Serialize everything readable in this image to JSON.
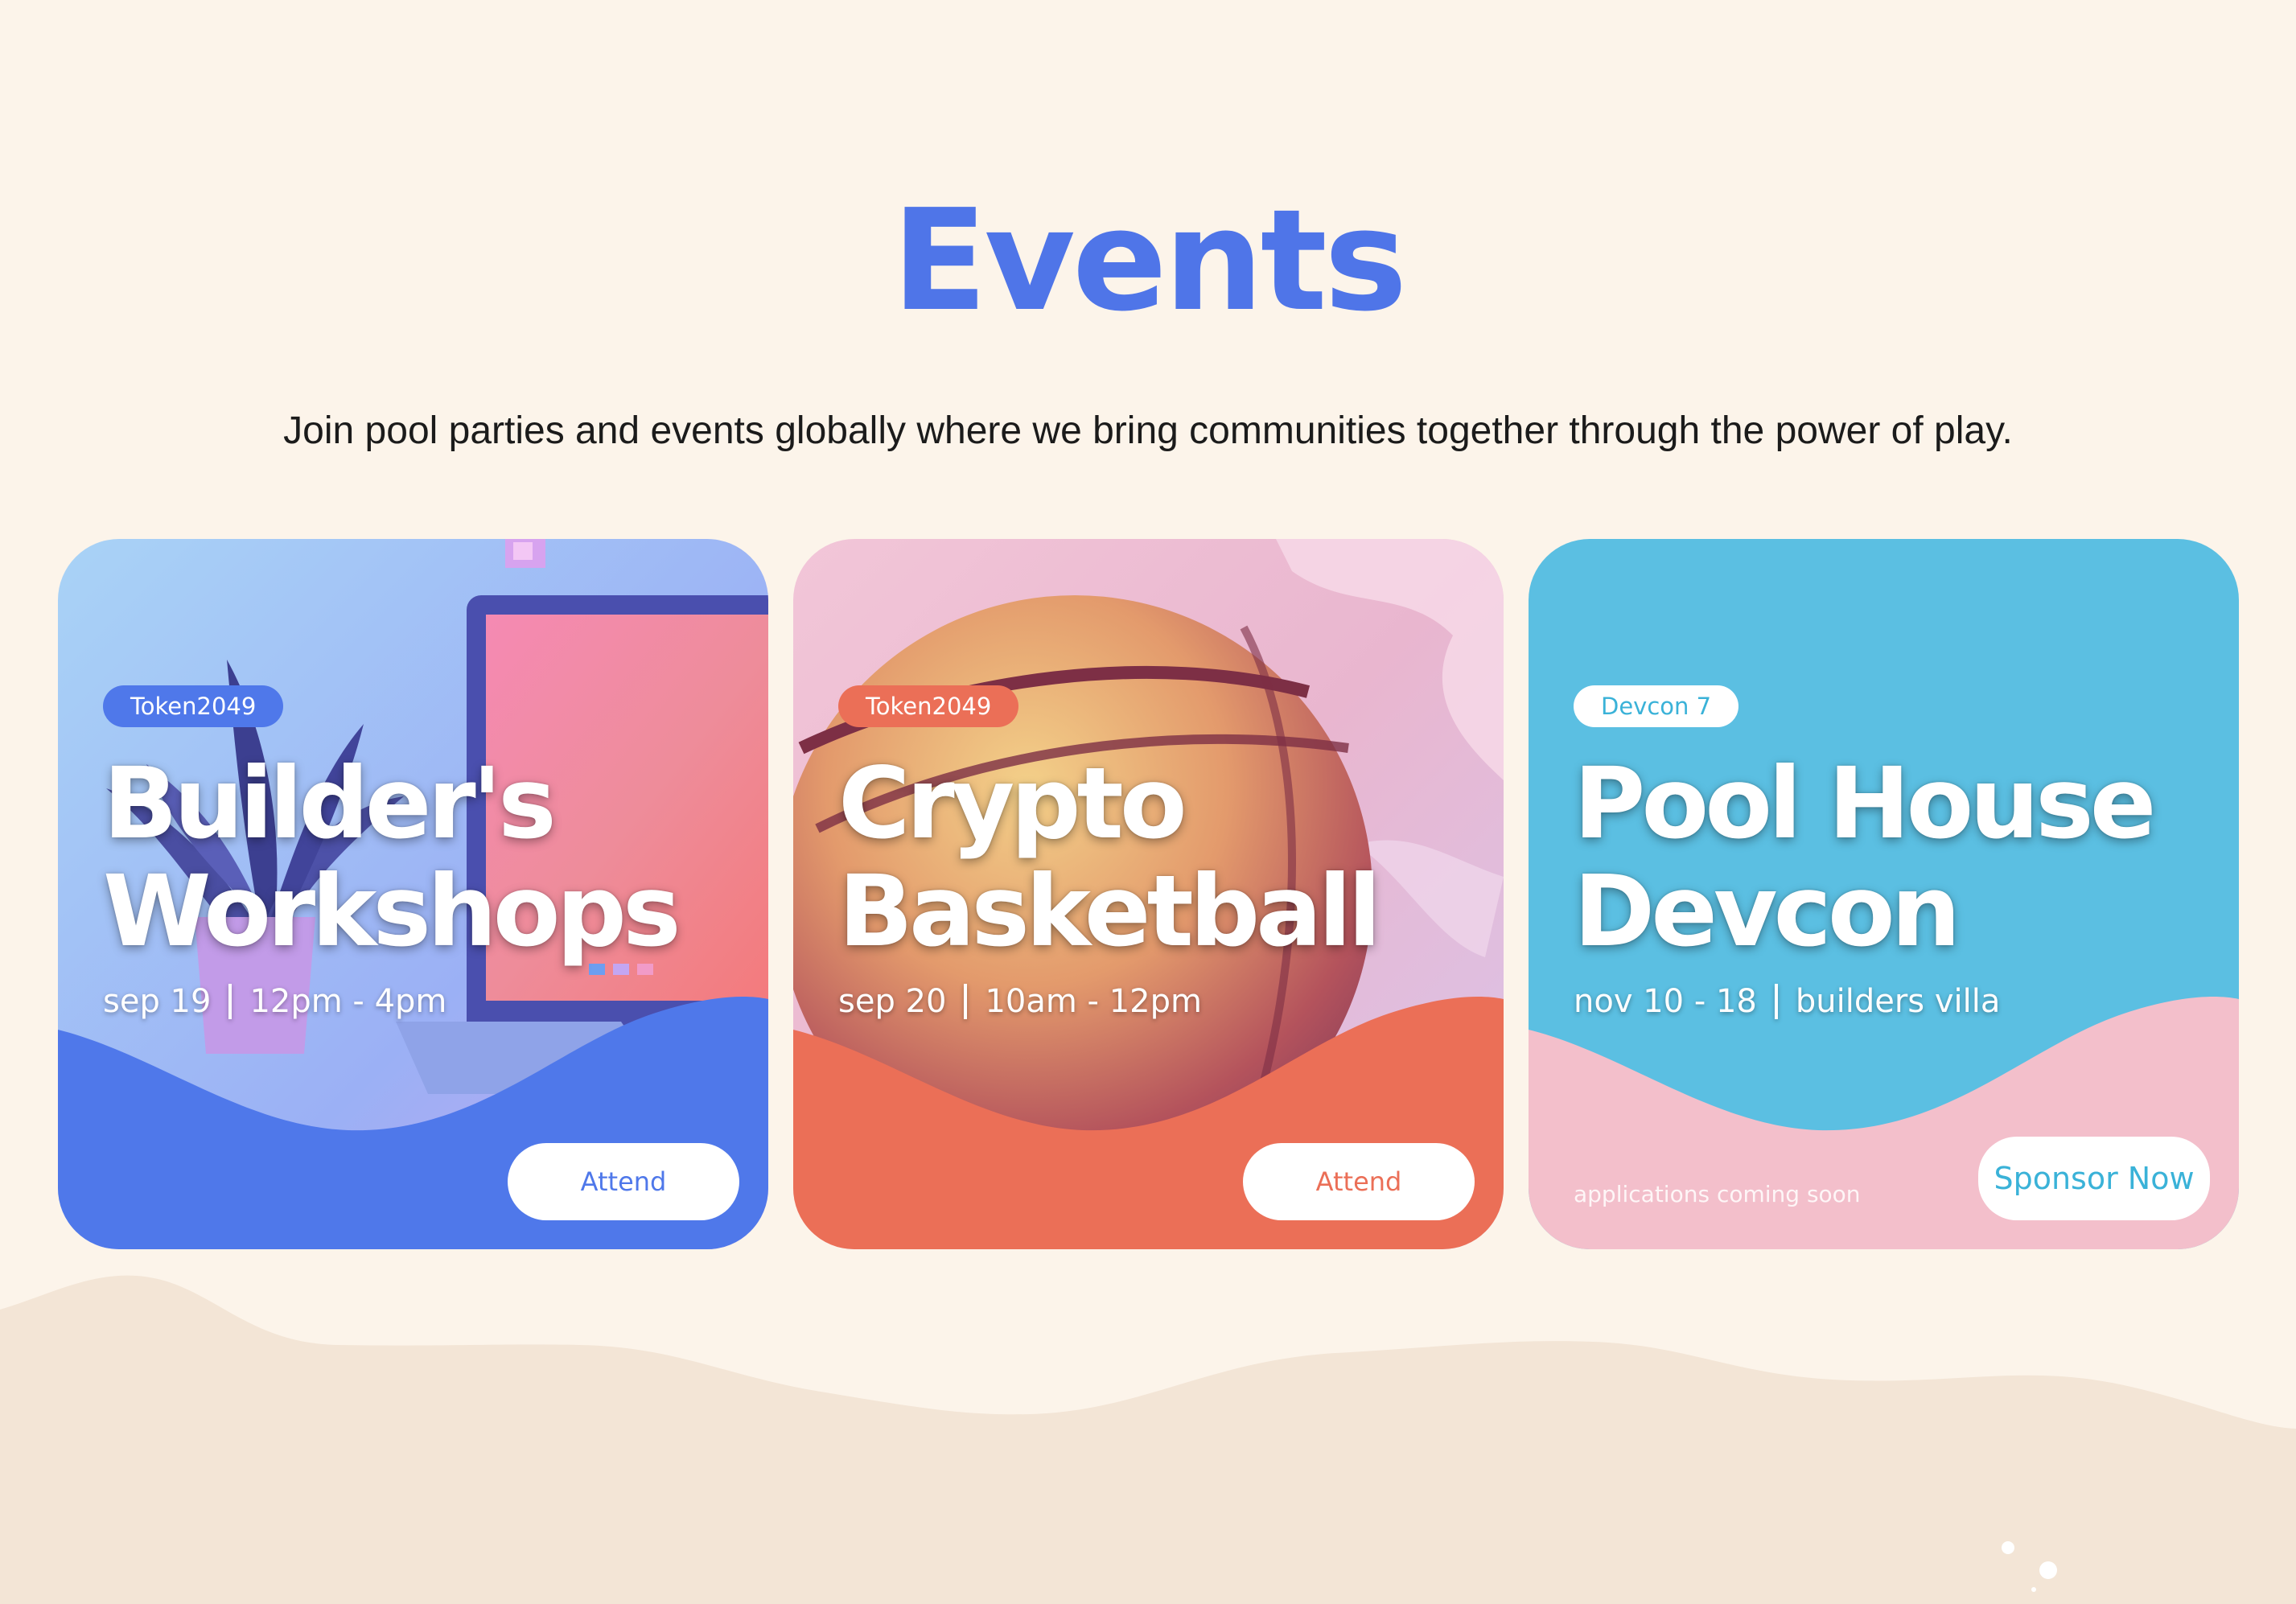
{
  "header": {
    "title": "Events",
    "subtitle": "Join pool parties and events globally where we bring communities together through the power of play."
  },
  "theme": {
    "background": "#fcf4ea",
    "title_color": "#4f75e8",
    "wave_color": "#f3e5d6"
  },
  "events": [
    {
      "tag": "Token2049",
      "title_line1": "Builder's",
      "title_line2": "Workshops",
      "date": "sep 19",
      "time": "12pm - 4pm",
      "button_label": "Attend",
      "accent": "#4f78ea",
      "image": "laptop-plant-icon"
    },
    {
      "tag": "Token2049",
      "title_line1": "Crypto",
      "title_line2": "Basketball",
      "date": "sep 20",
      "time": "10am - 12pm",
      "button_label": "Attend",
      "accent": "#eb6f57",
      "image": "basketball-icon"
    },
    {
      "tag": "Devcon 7",
      "title_line1": "Pool House",
      "title_line2": "Devcon",
      "date": "nov 10 - 18",
      "time": "builders villa",
      "button_label": "Sponsor Now",
      "note": "applications coming soon",
      "accent": "#5bbfe2",
      "secondary": "#f3bfcb"
    }
  ]
}
